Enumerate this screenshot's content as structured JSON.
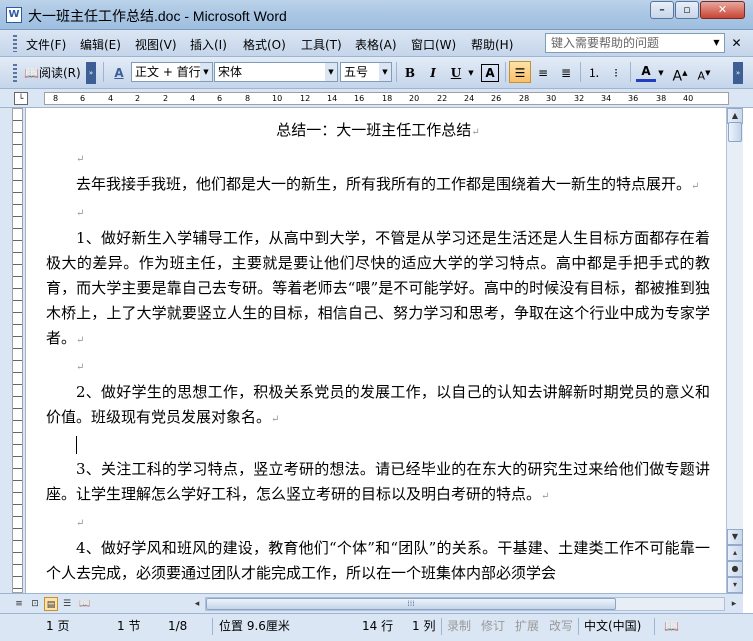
{
  "window": {
    "title": "大一班主任工作总结.doc - Microsoft Word",
    "app_icon": "W"
  },
  "menu": {
    "items": [
      "文件(F)",
      "编辑(E)",
      "视图(V)",
      "插入(I)",
      "格式(O)",
      "工具(T)",
      "表格(A)",
      "窗口(W)",
      "帮助(H)"
    ],
    "help_placeholder": "键入需要帮助的问题"
  },
  "toolbar": {
    "read_mode": "阅读(R)",
    "style": "正文 + 首行",
    "font": "宋体",
    "size": "五号",
    "bold": "B",
    "italic": "I",
    "underline": "U",
    "char_border": "A",
    "font_color": "A",
    "grow_font": "A",
    "shrink_font": "A"
  },
  "ruler": {
    "ticks": [
      "8",
      "6",
      "4",
      "2",
      "2",
      "4",
      "6",
      "8",
      "10",
      "12",
      "14",
      "16",
      "18",
      "20",
      "22",
      "24",
      "26",
      "28",
      "30",
      "32",
      "34",
      "36",
      "38",
      "40"
    ]
  },
  "document": {
    "title": "总结一：大一班主任工作总结",
    "paragraphs": [
      "去年我接手我班，他们都是大一的新生，所有我所有的工作都是围绕着大一新生的特点展开。",
      "1、做好新生入学辅导工作，从高中到大学，不管是从学习还是生活还是人生目标方面都存在着极大的差异。作为班主任，主要就是要让他们尽快的适应大学的学习特点。高中都是手把手式的教育，而大学主要是靠自己去专研。等着老师去“喂”是不可能学好。高中的时候没有目标，都被推到独木桥上，上了大学就要竖立人生的目标，相信自己、努力学习和思考，争取在这个行业中成为专家学者。",
      "2、做好学生的思想工作，积极关系党员的发展工作，以自己的认知去讲解新时期党员的意义和价值。班级现有党员发展对象名。",
      "3、关注工科的学习特点，竖立考研的想法。请已经毕业的在东大的研究生过来给他们做专题讲座。让学生理解怎么学好工科，怎么竖立考研的目标以及明白考研的特点。",
      "4、做好学风和班风的建设，教育他们“个体”和“团队”的关系。干基建、土建类工作不可能靠一个人去完成，必须要通过团队才能完成工作，所以在一个班集体内部必须学会"
    ],
    "para_mark": "↵"
  },
  "status": {
    "page": "1 页",
    "section": "1 节",
    "page_of": "1/8",
    "position": "位置 9.6厘米",
    "line": "14 行",
    "column": "1 列",
    "rec": "录制",
    "trk": "修订",
    "ext": "扩展",
    "ovr": "改写",
    "language": "中文(中国)"
  },
  "colors": {
    "accent": "#c8902e",
    "chrome": "#dbe6f4",
    "font_color": "#1f3fbf"
  }
}
